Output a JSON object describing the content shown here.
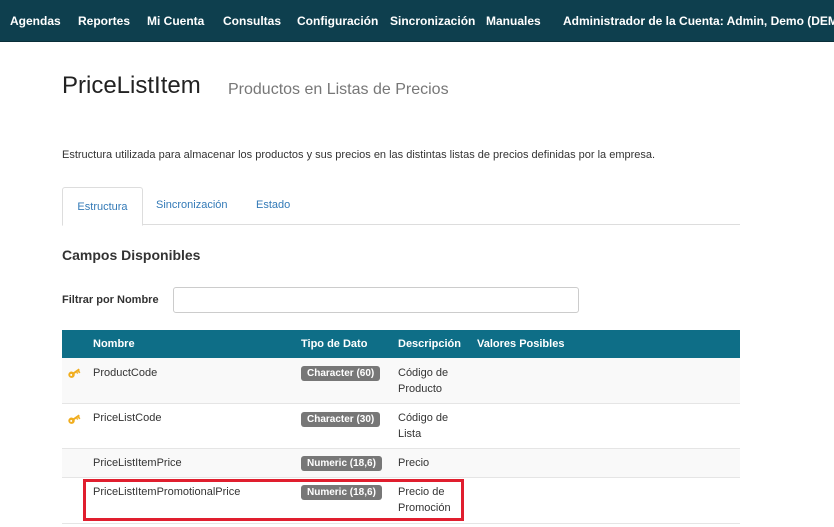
{
  "navbar": {
    "items": [
      "Agendas",
      "Reportes",
      "Mi Cuenta",
      "Consultas",
      "Configuración",
      "Sincronización",
      "Manuales"
    ],
    "account_label": "Administrador de la Cuenta: Admin, Demo (DEMO)"
  },
  "page": {
    "title": "PriceListItem",
    "subtitle": "Productos en Listas de Precios",
    "description": "Estructura utilizada para almacenar los productos y sus precios en las distintas listas de precios definidas por la empresa."
  },
  "tabs": [
    "Estructura",
    "Sincronización",
    "Estado"
  ],
  "active_tab": "Estructura",
  "section": {
    "title": "Campos Disponibles",
    "filter_label": "Filtrar por Nombre",
    "filter_value": ""
  },
  "table": {
    "headers": [
      "Nombre",
      "Tipo de Dato",
      "Descripción",
      "Valores Posibles"
    ],
    "rows": [
      {
        "key": true,
        "name": "ProductCode",
        "type": "Character (60)",
        "description": "Código de Producto",
        "values": ""
      },
      {
        "key": true,
        "name": "PriceListCode",
        "type": "Character (30)",
        "description": "Código de Lista",
        "values": ""
      },
      {
        "key": false,
        "name": "PriceListItemPrice",
        "type": "Numeric (18,6)",
        "description": "Precio",
        "values": ""
      },
      {
        "key": false,
        "name": "PriceListItemPromotionalPrice",
        "type": "Numeric (18,6)",
        "description": "Precio de Promoción",
        "values": ""
      }
    ]
  },
  "colors": {
    "navbar": "#0e3f4e",
    "table_header": "#0e6e87",
    "badge": "#777777",
    "key_icon": "#f0ad1e",
    "highlight": "#e01e2e",
    "link": "#337ab7"
  }
}
